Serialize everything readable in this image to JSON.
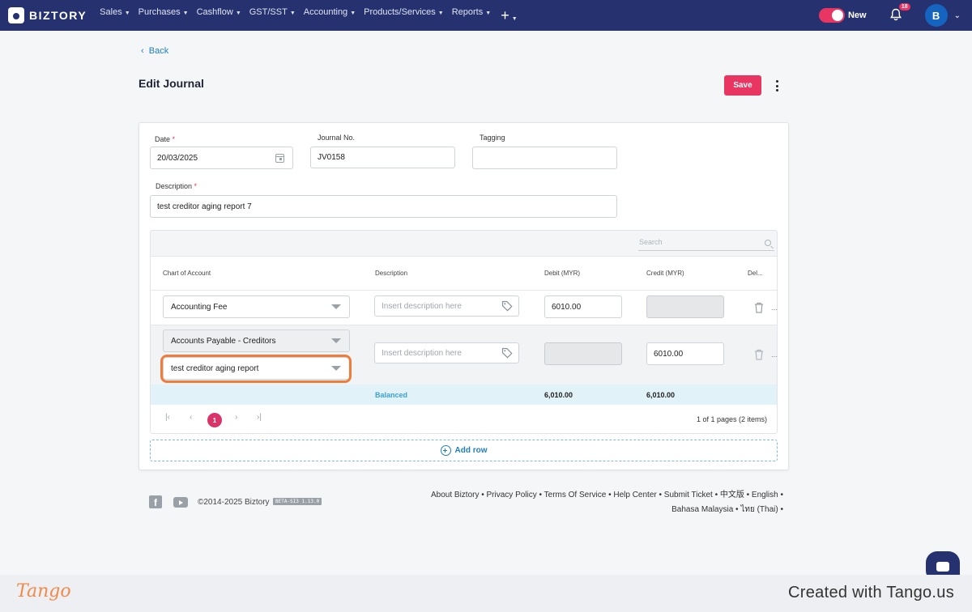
{
  "nav": {
    "brand": "BIZTORY",
    "menu": [
      "Sales",
      "Purchases",
      "Cashflow",
      "GST/SST",
      "Accounting",
      "Products/Services",
      "Reports"
    ],
    "new_label": "New",
    "notification_count": "18",
    "avatar_initial": "B"
  },
  "page": {
    "back_label": "Back",
    "title": "Edit Journal",
    "save_label": "Save"
  },
  "form": {
    "date_label": "Date",
    "date_value": "20/03/2025",
    "journal_no_label": "Journal No.",
    "journal_no_value": "JV0158",
    "tagging_label": "Tagging",
    "tagging_value": "",
    "description_label": "Description",
    "description_value": "test creditor aging report 7",
    "required_mark": "*"
  },
  "table": {
    "search_placeholder": "Search",
    "headers": [
      "Chart of Account",
      "Description",
      "Debit (MYR)",
      "Credit (MYR)",
      "Del..."
    ],
    "rows": [
      {
        "account": "Accounting Fee",
        "sub_account": "",
        "description_placeholder": "Insert description here",
        "debit": "6010.00",
        "credit": ""
      },
      {
        "account": "Accounts Payable - Creditors",
        "sub_account": "test creditor aging report",
        "description_placeholder": "Insert description here",
        "debit": "",
        "credit": "6010.00"
      }
    ],
    "more_label": "...",
    "balanced_label": "Balanced",
    "total_debit": "6,010.00",
    "total_credit": "6,010.00",
    "pager_first": "|‹",
    "pager_prev": "‹",
    "pager_next": "›",
    "pager_last": "›|",
    "current_page": "1",
    "page_info": "1 of 1 pages (2 items)",
    "add_row_label": "Add row"
  },
  "footer": {
    "facebook_letter": "f",
    "copyright": "©2014-2025 Biztory",
    "version": "BETA-SI3 1.13.0",
    "links_line1": "About Biztory • Privacy Policy • Terms Of Service • Help Center • Submit Ticket • 中文版 • English •",
    "links_line2": "Bahasa Malaysia • ไทย (Thai) •"
  },
  "tango": {
    "logo": "Tango",
    "created": "Created with Tango.us"
  },
  "colors": {
    "nav_bg": "#263270",
    "accent": "#e83562",
    "link": "#1e7fbf",
    "highlight": "#f07c3c"
  }
}
